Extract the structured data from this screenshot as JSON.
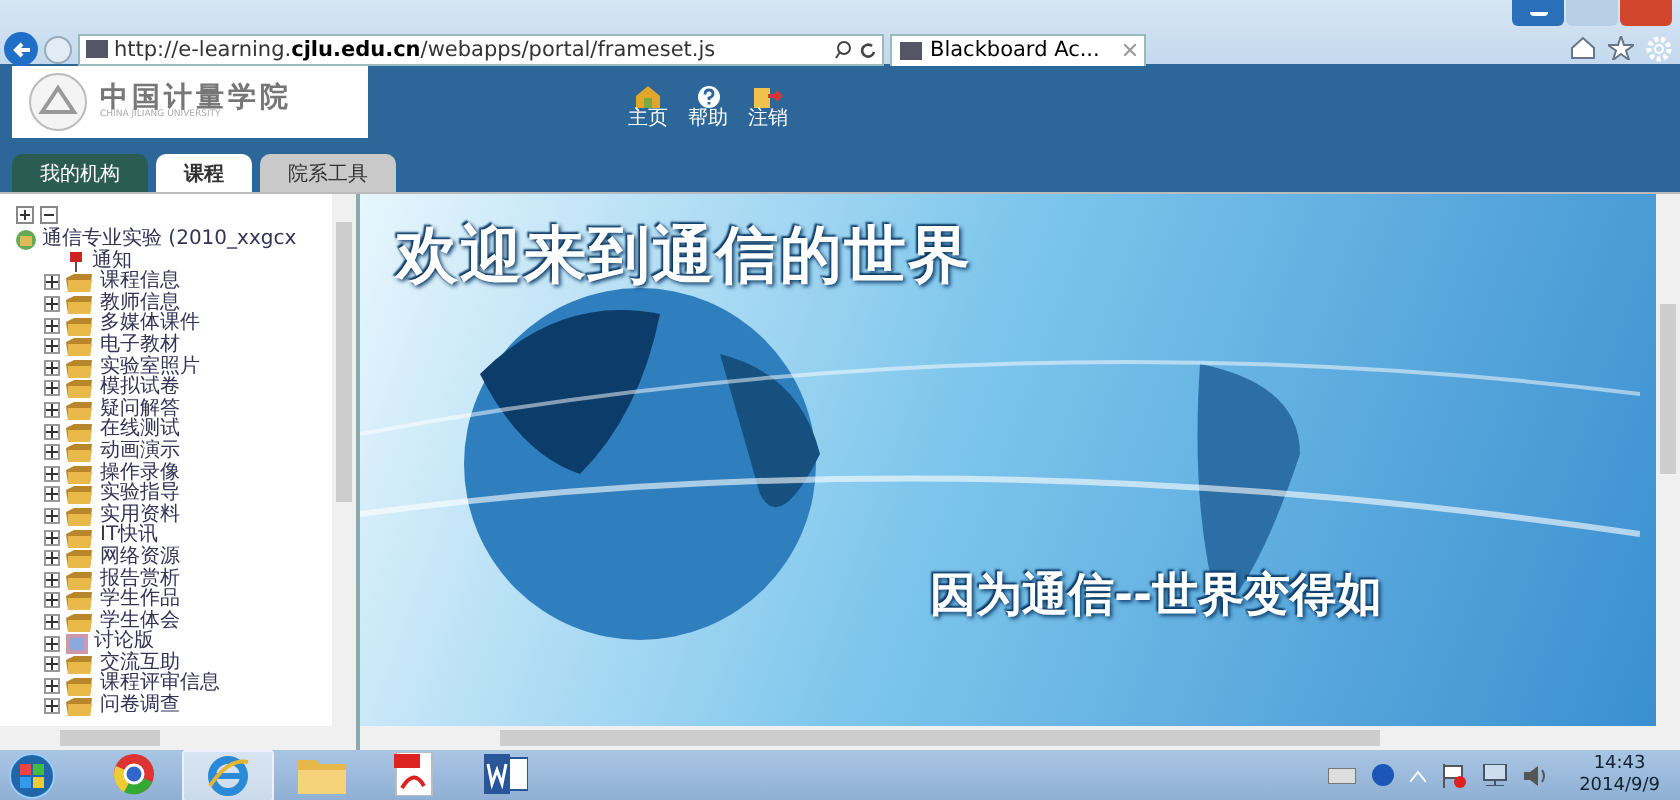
{
  "browser": {
    "address": "http://e-learning.**cjlu.edu.cn**/webapps/portal/frameset.js",
    "tab_title": "Blackboard Ac..."
  },
  "header": {
    "logo": {
      "name": "中国计量学院",
      "subtitle": "CHINA JILIANG UNIVERSITY"
    },
    "actions": [
      {
        "kind": "home",
        "label": "主页"
      },
      {
        "kind": "help",
        "label": "帮助"
      },
      {
        "kind": "logout",
        "label": "注销"
      }
    ],
    "tabs": [
      {
        "label": "我的机构",
        "selected": false,
        "kind": "institution"
      },
      {
        "label": "课程",
        "selected": true,
        "kind": "course"
      },
      {
        "label": "院系工具",
        "selected": false,
        "kind": "tools"
      }
    ]
  },
  "tree": {
    "root": {
      "label": "通信专业实验 (2010_xxgcx",
      "expanded": true,
      "children": [
        {
          "label": "通知",
          "kind": "notice"
        },
        {
          "label": "课程信息",
          "kind": "folder",
          "expanded": false
        },
        {
          "label": "教师信息",
          "kind": "folder",
          "expanded": false
        },
        {
          "label": "多媒体课件",
          "kind": "folder",
          "expanded": false
        },
        {
          "label": "电子教材",
          "kind": "folder",
          "expanded": false
        },
        {
          "label": "实验室照片",
          "kind": "folder",
          "expanded": false
        },
        {
          "label": "模拟试卷",
          "kind": "folder",
          "expanded": false
        },
        {
          "label": "疑问解答",
          "kind": "folder",
          "expanded": false
        },
        {
          "label": "在线测试",
          "kind": "folder",
          "expanded": false
        },
        {
          "label": "动画演示",
          "kind": "folder",
          "expanded": false
        },
        {
          "label": "操作录像",
          "kind": "folder",
          "expanded": false
        },
        {
          "label": "实验指导",
          "kind": "folder",
          "expanded": false
        },
        {
          "label": "实用资料",
          "kind": "folder",
          "expanded": false
        },
        {
          "label": "IT快讯",
          "kind": "folder",
          "expanded": false
        },
        {
          "label": "网络资源",
          "kind": "folder",
          "expanded": false
        },
        {
          "label": "报告赏析",
          "kind": "folder",
          "expanded": false
        },
        {
          "label": "学生作品",
          "kind": "folder",
          "expanded": false
        },
        {
          "label": "学生体会",
          "kind": "folder",
          "expanded": false
        },
        {
          "label": "讨论版",
          "kind": "forum",
          "expanded": false
        },
        {
          "label": "交流互助",
          "kind": "folder",
          "expanded": false
        },
        {
          "label": "课程评审信息",
          "kind": "folder",
          "expanded": false
        },
        {
          "label": "问卷调查",
          "kind": "folder",
          "expanded": false
        }
      ]
    }
  },
  "banner": {
    "title": "欢迎来到通信的世界",
    "slogan": "因为通信--世界变得如"
  },
  "taskbar": {
    "apps": [
      {
        "kind": "chrome",
        "selected": false
      },
      {
        "kind": "ie",
        "selected": true
      },
      {
        "kind": "folder",
        "selected": false
      },
      {
        "kind": "pdf",
        "selected": false
      },
      {
        "kind": "word",
        "selected": false
      }
    ],
    "time": "14:43",
    "date": "2014/9/9"
  }
}
